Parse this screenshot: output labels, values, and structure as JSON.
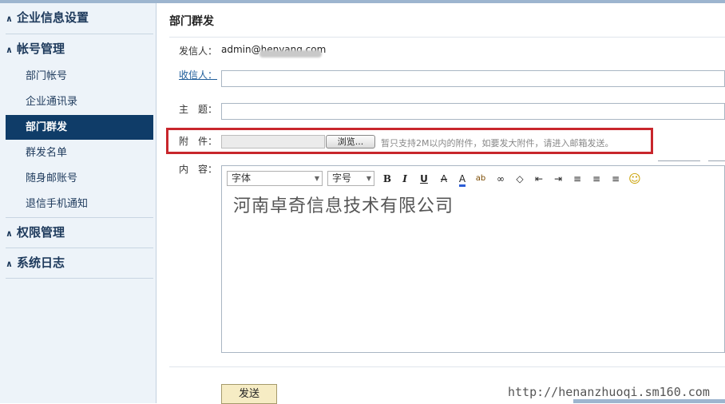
{
  "sidebar": {
    "sections": [
      {
        "label": "企业信息设置",
        "items": []
      },
      {
        "label": "帐号管理",
        "items": [
          "部门帐号",
          "企业通讯录",
          "部门群发",
          "群发名单",
          "随身邮账号",
          "退信手机通知"
        ]
      },
      {
        "label": "权限管理",
        "items": []
      },
      {
        "label": "系统日志",
        "items": []
      }
    ],
    "active_item": "部门群发"
  },
  "main": {
    "title": "部门群发",
    "sender_label": "发信人：",
    "sender_value": "admin@henyang.com",
    "recipient_label": "收信人：",
    "subject_label": "主　题：",
    "attachment_label": "附　件：",
    "browse_label": "浏览...",
    "attachment_hint": "暂只支持2M以内的附件，如要发大附件，请进入邮箱发送。",
    "content_label": "内　容：",
    "toolbar": {
      "font_select": "字体",
      "size_select": "字号",
      "buttons": [
        "bold",
        "italic",
        "underline",
        "strikethrough",
        "font-color",
        "highlight",
        "link",
        "eraser",
        "outdent",
        "indent",
        "align-left",
        "align-center",
        "align-right",
        "emoticon"
      ]
    },
    "content_text": "河南卓奇信息技术有限公司",
    "send_label": "发送"
  },
  "watermark": "http://henanzhuoqi.sm160.com",
  "colors": {
    "active_bg": "#0f3c68",
    "highlight_border": "#c8262c",
    "sidebar_bg": "#edf3f9"
  }
}
